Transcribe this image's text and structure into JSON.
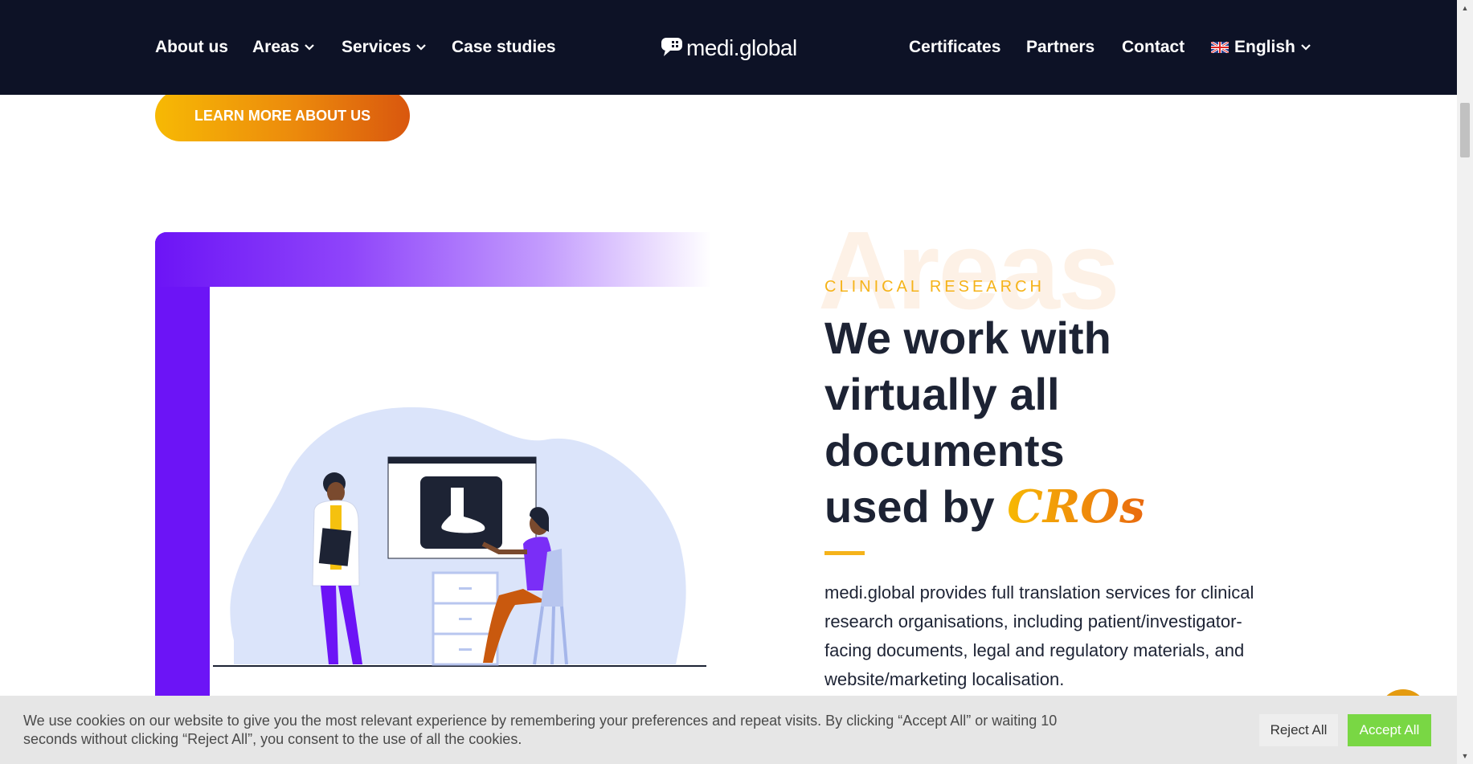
{
  "header": {
    "logo_text": "medi.global",
    "nav_left": [
      {
        "label": "About us",
        "has_dropdown": false
      },
      {
        "label": "Areas",
        "has_dropdown": true
      },
      {
        "label": "Services",
        "has_dropdown": true
      },
      {
        "label": "Case studies",
        "has_dropdown": false
      }
    ],
    "nav_right": [
      {
        "label": "Certificates"
      },
      {
        "label": "Partners"
      },
      {
        "label": "Contact"
      }
    ],
    "language": {
      "label": "English",
      "icon": "uk-flag-icon"
    }
  },
  "cta": {
    "learn_more_label": "LEARN MORE ABOUT US"
  },
  "section": {
    "watermark": "Areas",
    "eyebrow": "CLINICAL RESEARCH",
    "headline_lines": [
      "We work with",
      "virtually all",
      "documents",
      "used by"
    ],
    "headline_highlight": "CROs",
    "body": "medi.global provides full translation services for clinical research organisations, including patient/investigator-facing documents, legal and regulatory materials, and website/marketing localisation."
  },
  "cookie_banner": {
    "text": "We use cookies on our website to give you the most relevant experience by remembering your preferences and repeat visits. By clicking “Accept All” or waiting 10 seconds without clicking “Reject All”, you consent to the use of all the cookies.",
    "reject_label": "Reject All",
    "accept_label": "Accept All"
  },
  "colors": {
    "header_bg": "#0d1226",
    "accent_orange": "#f5b31a",
    "accent_purple": "#6c14f6",
    "accept_green": "#79d744",
    "text_dark": "#1d2334"
  }
}
